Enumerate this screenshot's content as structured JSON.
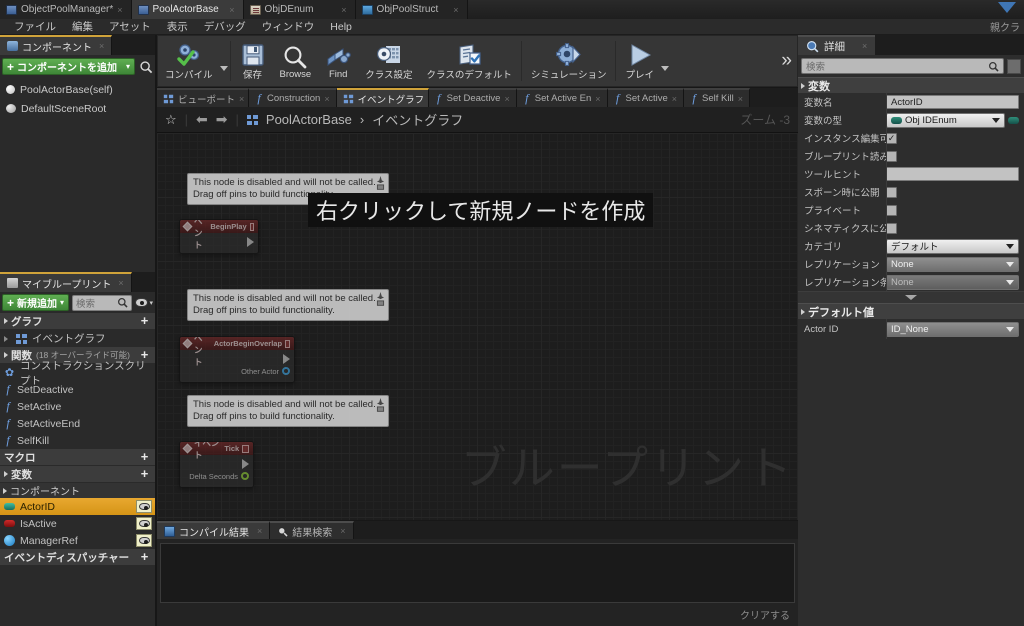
{
  "window": {
    "tabs": [
      {
        "label": "ObjectPoolManager*",
        "icon": "blueprint-icon",
        "active": false,
        "close": "×"
      },
      {
        "label": "PoolActorBase",
        "icon": "blueprint-icon",
        "active": true,
        "close": "×"
      },
      {
        "label": "ObjDEnum",
        "icon": "enum-icon",
        "active": false,
        "close": "×"
      },
      {
        "label": "ObjPoolStruct",
        "icon": "struct-icon",
        "active": false,
        "close": "×"
      }
    ]
  },
  "menubar": {
    "items": [
      "ファイル",
      "編集",
      "アセット",
      "表示",
      "デバッグ",
      "ウィンドウ",
      "Help"
    ],
    "right_label": "親クラ"
  },
  "components_panel": {
    "tab_label": "コンポーネント",
    "tab_close": "×",
    "add_button": "コンポーネントを追加",
    "add_plus": "+",
    "add_caret": "▾",
    "items": [
      {
        "label": "PoolActorBase(self)",
        "icon": "sphere-icon"
      },
      {
        "label": "DefaultSceneRoot",
        "icon": "scene-root-icon"
      }
    ]
  },
  "myblueprint_panel": {
    "tab_label": "マイブループリント",
    "tab_close": "×",
    "add_button": "新規追加",
    "add_plus": "+",
    "add_caret": "▾",
    "search_placeholder": "検索",
    "sections": [
      {
        "title": "グラフ",
        "plus": "+",
        "items": [
          {
            "label": "イベントグラフ",
            "icon": "event-graph-icon",
            "type": "graph"
          }
        ]
      },
      {
        "title": "関数",
        "subtitle": "(18 オーバーライド可能)",
        "plus": "+",
        "items": [
          {
            "label": "コンストラクションスクリプト",
            "icon": "construction-script-icon",
            "type": "function"
          },
          {
            "label": "SetDeactive",
            "icon": "function-icon",
            "type": "function"
          },
          {
            "label": "SetActive",
            "icon": "function-icon",
            "type": "function"
          },
          {
            "label": "SetActiveEnd",
            "icon": "function-icon",
            "type": "function"
          },
          {
            "label": "SelfKill",
            "icon": "function-icon",
            "type": "function"
          }
        ]
      },
      {
        "title": "マクロ",
        "plus": "+",
        "items": []
      },
      {
        "title": "変数",
        "plus": "+",
        "subgroup": "コンポーネント",
        "items": [
          {
            "label": "ActorID",
            "type": "variable",
            "color": "#2f8f7a",
            "selected": true,
            "eye": "eye-icon"
          },
          {
            "label": "IsActive",
            "type": "variable",
            "color": "#a81212",
            "selected": false,
            "eye": "eye-icon"
          },
          {
            "label": "ManagerRef",
            "type": "variable",
            "color": "#2f9ee0",
            "selected": false,
            "eye": "eye-icon"
          }
        ]
      },
      {
        "title": "イベントディスパッチャー",
        "plus": "+",
        "items": []
      }
    ]
  },
  "toolbar": {
    "buttons": [
      {
        "label": "コンパイル",
        "icon": "compile-icon",
        "has_caret": true
      },
      {
        "label": "保存",
        "icon": "save-icon",
        "has_caret": false
      },
      {
        "label": "Browse",
        "icon": "browse-icon",
        "has_caret": false
      },
      {
        "label": "Find",
        "icon": "find-icon",
        "has_caret": false
      },
      {
        "label": "クラス設定",
        "icon": "class-settings-icon",
        "has_caret": false
      },
      {
        "label": "クラスのデフォルト",
        "icon": "class-defaults-icon",
        "has_caret": false
      },
      {
        "label": "シミュレーション",
        "icon": "simulate-icon",
        "has_caret": false
      },
      {
        "label": "プレイ",
        "icon": "play-icon",
        "has_caret": true
      }
    ],
    "overflow": "»"
  },
  "graph_panel": {
    "tabs": [
      {
        "label": "ビューポート",
        "icon": "viewport-icon",
        "selected": false,
        "close": "×"
      },
      {
        "label": "Construction",
        "icon": "function-icon",
        "selected": false,
        "close": "×"
      },
      {
        "label": "イベントグラフ",
        "icon": "event-graph-icon",
        "selected": true,
        "close": "×"
      },
      {
        "label": "Set Deactive",
        "icon": "function-icon",
        "selected": false,
        "close": "×"
      },
      {
        "label": "Set Active En",
        "icon": "function-icon",
        "selected": false,
        "close": "×"
      },
      {
        "label": "Set Active",
        "icon": "function-icon",
        "selected": false,
        "close": "×"
      },
      {
        "label": "Self Kill",
        "icon": "function-icon",
        "selected": false,
        "close": "×"
      }
    ],
    "breadcrumb": {
      "star": "☆",
      "back": "⬅",
      "forward": "➡",
      "icon": "event-graph-icon",
      "root": "PoolActorBase",
      "separator": "›",
      "current": "イベントグラフ",
      "zoom_label": "ズーム",
      "zoom_value": "-3"
    },
    "hint_banner": "右クリックして新規ノードを作成",
    "watermark": "ブループリント",
    "note_text_line1": "This node is disabled and will not be called.",
    "note_text_line2": "Drag off pins to build functionality.",
    "nodes": [
      {
        "title": "イベント BeginPlay",
        "title_prefix": "イベント",
        "title_name": "BeginPlay",
        "pins": [
          {
            "label": "",
            "kind": "exec"
          }
        ]
      },
      {
        "title": "イベント ActorBeginOverlap",
        "title_prefix": "イベント",
        "title_name": "ActorBeginOverlap",
        "pins": [
          {
            "label": "",
            "kind": "exec"
          },
          {
            "label": "Other Actor",
            "kind": "object"
          }
        ]
      },
      {
        "title": "イベント Tick",
        "title_prefix": "イベント",
        "title_name": "Tick",
        "pins": [
          {
            "label": "",
            "kind": "exec"
          },
          {
            "label": "Delta Seconds",
            "kind": "float"
          }
        ]
      }
    ]
  },
  "results_panel": {
    "tabs": [
      {
        "label": "コンパイル結果",
        "icon": "compile-results-icon",
        "selected": true,
        "close": "×"
      },
      {
        "label": "結果検索",
        "icon": "find-results-icon",
        "selected": false,
        "close": "×"
      }
    ],
    "clear_label": "クリアする"
  },
  "details_panel": {
    "tab_label": "詳細",
    "tab_close": "×",
    "search_placeholder": "検索",
    "sections": [
      {
        "title": "変数",
        "rows": [
          {
            "label": "変数名",
            "control": "text",
            "value": "ActorID"
          },
          {
            "label": "変数の型",
            "control": "enum-dropdown",
            "value": "Obj IDEnum"
          },
          {
            "label": "インスタンス編集可能",
            "control": "checkbox",
            "value": true
          },
          {
            "label": "ブループリント読み取",
            "control": "checkbox",
            "value": false
          },
          {
            "label": "ツールヒント",
            "control": "text",
            "value": ""
          },
          {
            "label": "スポーン時に公開",
            "control": "checkbox",
            "value": false
          },
          {
            "label": "プライベート",
            "control": "checkbox",
            "value": false
          },
          {
            "label": "シネマティクスに公開",
            "control": "checkbox",
            "value": false
          },
          {
            "label": "カテゴリ",
            "control": "dropdown-light",
            "value": "デフォルト"
          },
          {
            "label": "レプリケーション",
            "control": "dropdown-dark",
            "value": "None"
          },
          {
            "label": "レプリケーション条件",
            "control": "dropdown-disabled",
            "value": "None"
          }
        ]
      },
      {
        "title": "デフォルト値",
        "rows": [
          {
            "label": "Actor ID",
            "control": "dropdown-dark",
            "value": "ID_None"
          }
        ]
      }
    ]
  },
  "colors": {
    "accent_green": "#3e8637",
    "selection_orange": "#d59416",
    "event_node_red": "#7a2a2a",
    "exec_pin": "#c9c9c9",
    "object_pin": "#3fa9e8",
    "float_pin": "#93d13a",
    "enum_teal": "#2f8f7a",
    "panel_bg": "#2d2d2d",
    "canvas_bg": "#1d1d1d"
  }
}
